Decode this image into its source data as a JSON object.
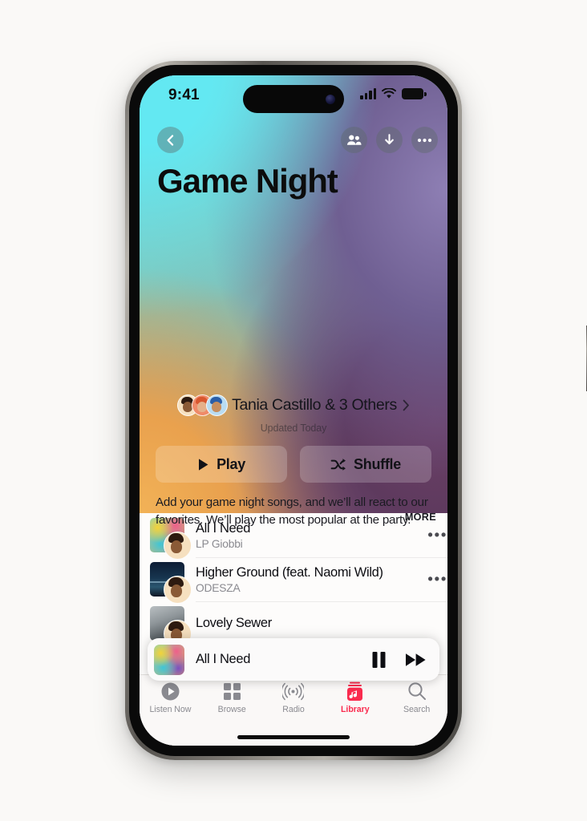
{
  "status_bar": {
    "time": "9:41",
    "cellular_icon": "signal-bars-icon",
    "wifi_icon": "wifi-icon",
    "battery_icon": "battery-icon"
  },
  "nav": {
    "back_icon": "chevron-left-icon",
    "collaborate_icon": "people-icon",
    "download_icon": "download-arrow-icon",
    "more_icon": "ellipsis-icon"
  },
  "playlist": {
    "title": "Game Night",
    "collaborators_label": "Tania Castillo & 3 Others",
    "collaborators_chevron_icon": "chevron-right-icon",
    "updated_label": "Updated Today",
    "description": "Add your game night songs, and we’ll all react to our favorites. We’ll play the most popular at the party.",
    "more_label": "MORE"
  },
  "actions": {
    "play_label": "Play",
    "play_icon": "play-triangle-icon",
    "shuffle_label": "Shuffle",
    "shuffle_icon": "shuffle-icon"
  },
  "tracks": [
    {
      "title": "All I Need",
      "artist": "LP Giobbi",
      "more_icon": "ellipsis-icon"
    },
    {
      "title": "Higher Ground (feat. Naomi Wild)",
      "artist": "ODESZA",
      "more_icon": "ellipsis-icon"
    },
    {
      "title": "Lovely Sewer",
      "artist": "",
      "more_icon": "ellipsis-icon"
    }
  ],
  "now_playing": {
    "title": "All I Need",
    "pause_icon": "pause-icon",
    "next_icon": "fast-forward-icon"
  },
  "tabbar": {
    "active": "Library",
    "items": [
      {
        "label": "Listen Now",
        "icon": "play-circle-icon"
      },
      {
        "label": "Browse",
        "icon": "grid-squares-icon"
      },
      {
        "label": "Radio",
        "icon": "radio-waves-icon"
      },
      {
        "label": "Library",
        "icon": "library-icon"
      },
      {
        "label": "Search",
        "icon": "magnifier-icon"
      }
    ]
  },
  "colors": {
    "accent": "#fa2b4e",
    "page_background": "#faf9f7",
    "list_background": "#fdfcfb",
    "gradient_top_left": "#63e8f2",
    "gradient_right": "#6f5f92",
    "gradient_bottom_left": "#f2b257",
    "secondary_text": "#8a8a90"
  }
}
